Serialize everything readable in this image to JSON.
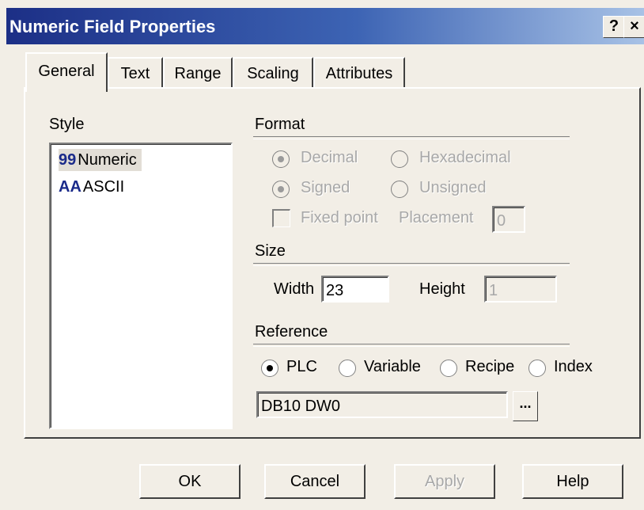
{
  "window": {
    "title": "Numeric Field Properties",
    "help_button": "?",
    "close_button": "×"
  },
  "tabs": [
    {
      "label": "General",
      "active": true
    },
    {
      "label": "Text",
      "active": false
    },
    {
      "label": "Range",
      "active": false
    },
    {
      "label": "Scaling",
      "active": false
    },
    {
      "label": "Attributes",
      "active": false
    }
  ],
  "style": {
    "label": "Style",
    "items": [
      {
        "glyph": "99",
        "label": "Numeric",
        "selected": true
      },
      {
        "glyph": "AA",
        "label": "ASCII",
        "selected": false
      }
    ]
  },
  "format": {
    "label": "Format",
    "decimal": "Decimal",
    "hexadecimal": "Hexadecimal",
    "signed": "Signed",
    "unsigned": "Unsigned",
    "fixed_point": "Fixed point",
    "placement_label": "Placement",
    "placement_value": "0"
  },
  "size": {
    "label": "Size",
    "width_label": "Width",
    "width_value": "23",
    "height_label": "Height",
    "height_value": "1"
  },
  "reference": {
    "label": "Reference",
    "plc": "PLC",
    "variable": "Variable",
    "recipe": "Recipe",
    "index": "Index",
    "address_value": "DB10 DW0",
    "browse_button": "..."
  },
  "buttons": {
    "ok": "OK",
    "cancel": "Cancel",
    "apply": "Apply",
    "help": "Help"
  }
}
